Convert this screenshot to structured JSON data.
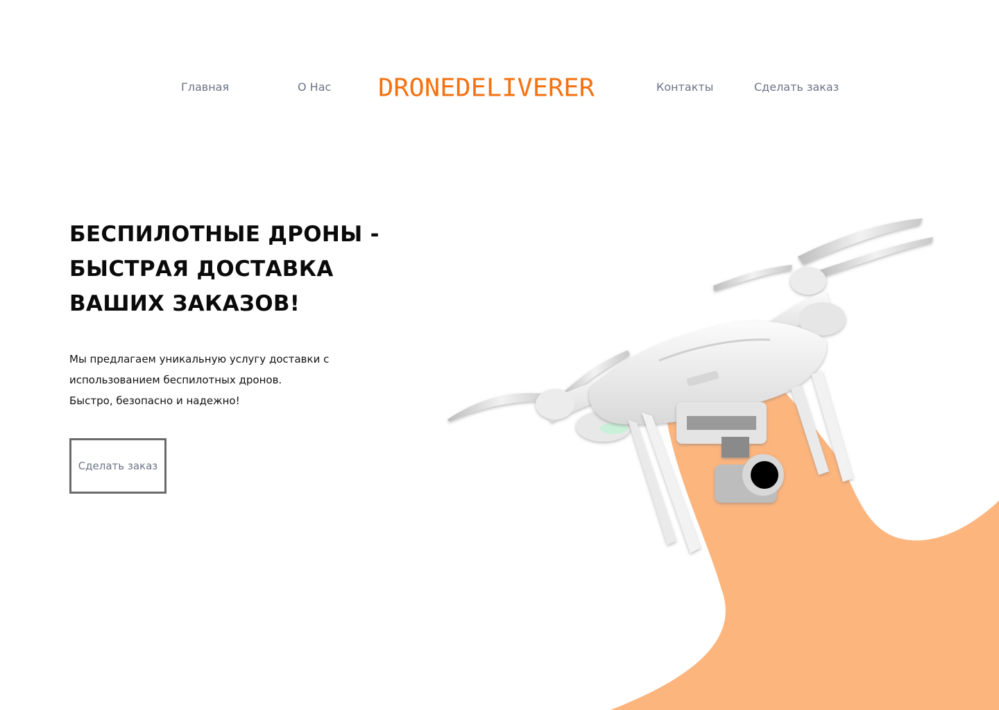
{
  "brand": {
    "logo_text": "DRONEDELIVERER",
    "accent_color": "#f47212",
    "blob_color": "#fdb57e"
  },
  "nav": {
    "home": "Главная",
    "about": "О Нас",
    "contacts": "Контакты",
    "order": "Сделать заказ"
  },
  "hero": {
    "title_lines": [
      "БЕСПИЛОТНЫЕ ДРОНЫ -",
      "БЫСТРАЯ ДОСТАВКА",
      "ВАШИХ ЗАКАЗОВ!"
    ],
    "text_lines": [
      "Мы предлагаем уникальную услугу доставки с",
      "использованием беспилотных дронов.",
      "Быстро, безопасно и надежно!"
    ],
    "cta_label": "Сделать заказ"
  },
  "illustration": {
    "icon": "drone-icon"
  }
}
